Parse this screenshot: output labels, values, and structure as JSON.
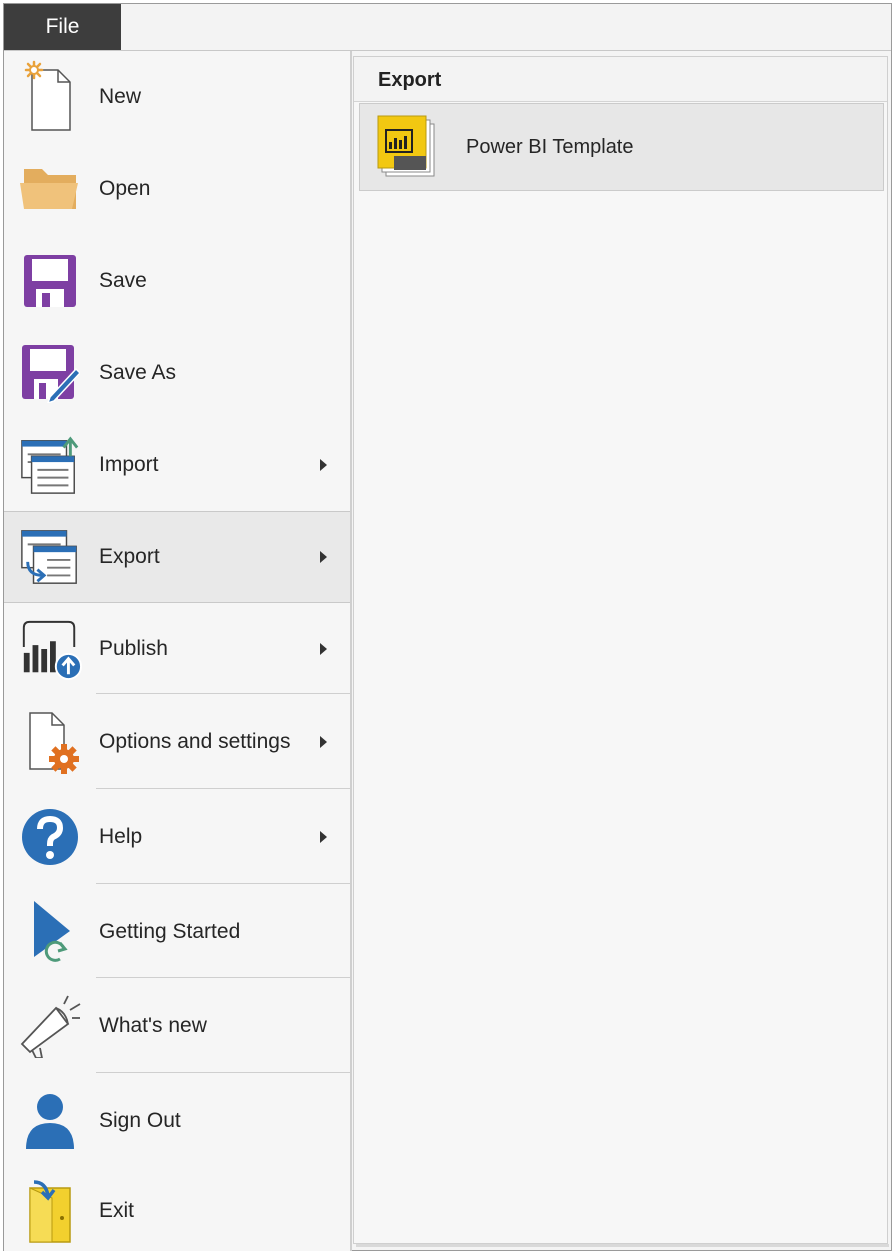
{
  "topbar": {
    "file_tab": "File"
  },
  "menu": {
    "items": [
      {
        "label": "New",
        "icon": "new-document-icon",
        "has_submenu": false
      },
      {
        "label": "Open",
        "icon": "folder-icon",
        "has_submenu": false
      },
      {
        "label": "Save",
        "icon": "save-disk-icon",
        "has_submenu": false
      },
      {
        "label": "Save As",
        "icon": "save-as-icon",
        "has_submenu": false
      },
      {
        "label": "Import",
        "icon": "import-icon",
        "has_submenu": true
      },
      {
        "label": "Export",
        "icon": "export-icon",
        "has_submenu": true,
        "selected": true
      },
      {
        "label": "Publish",
        "icon": "publish-icon",
        "has_submenu": true
      },
      {
        "label": "Options and settings",
        "icon": "options-gear-icon",
        "has_submenu": true
      },
      {
        "label": "Help",
        "icon": "help-icon",
        "has_submenu": true
      },
      {
        "label": "Getting Started",
        "icon": "getting-started-icon",
        "has_submenu": false
      },
      {
        "label": "What's new",
        "icon": "megaphone-icon",
        "has_submenu": false
      },
      {
        "label": "Sign Out",
        "icon": "user-icon",
        "has_submenu": false
      },
      {
        "label": "Exit",
        "icon": "exit-icon",
        "has_submenu": false
      }
    ]
  },
  "export_panel": {
    "title": "Export",
    "options": [
      {
        "label": "Power BI Template",
        "icon": "power-bi-template-icon"
      }
    ]
  },
  "colors": {
    "file_tab_bg": "#3d3d3d",
    "save_purple": "#7e3fa3",
    "accent_blue": "#2b6fb6",
    "folder_tan": "#f0c27b",
    "powerbi_yellow": "#f2c811"
  }
}
